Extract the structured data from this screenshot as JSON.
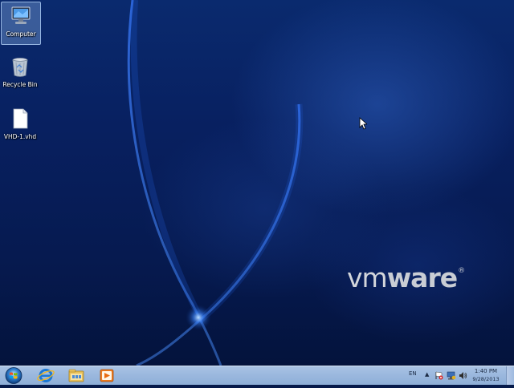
{
  "desktop": {
    "icons": [
      {
        "label": "Computer",
        "icon": "computer-icon",
        "selected": true
      },
      {
        "label": "Recycle Bin",
        "icon": "recycle-bin-icon",
        "selected": false
      },
      {
        "label": "VHD-1.vhd",
        "icon": "file-icon",
        "selected": false
      }
    ],
    "logo": {
      "prefix": "vm",
      "suffix": "ware",
      "mark": "®"
    }
  },
  "taskbar": {
    "pinned": [
      {
        "name": "internet-explorer-icon"
      },
      {
        "name": "windows-explorer-icon"
      },
      {
        "name": "windows-media-player-icon"
      }
    ],
    "tray": {
      "language": "EN",
      "expand_arrow": "▲",
      "icons": [
        "action-center-flag-icon",
        "network-icon",
        "volume-icon"
      ],
      "time": "1:40 PM",
      "date": "9/28/2013"
    }
  },
  "colors": {
    "desktop_bg": "#061a4a",
    "taskbar_bg": "#9bb8de",
    "logo": "#c9cdd4"
  }
}
